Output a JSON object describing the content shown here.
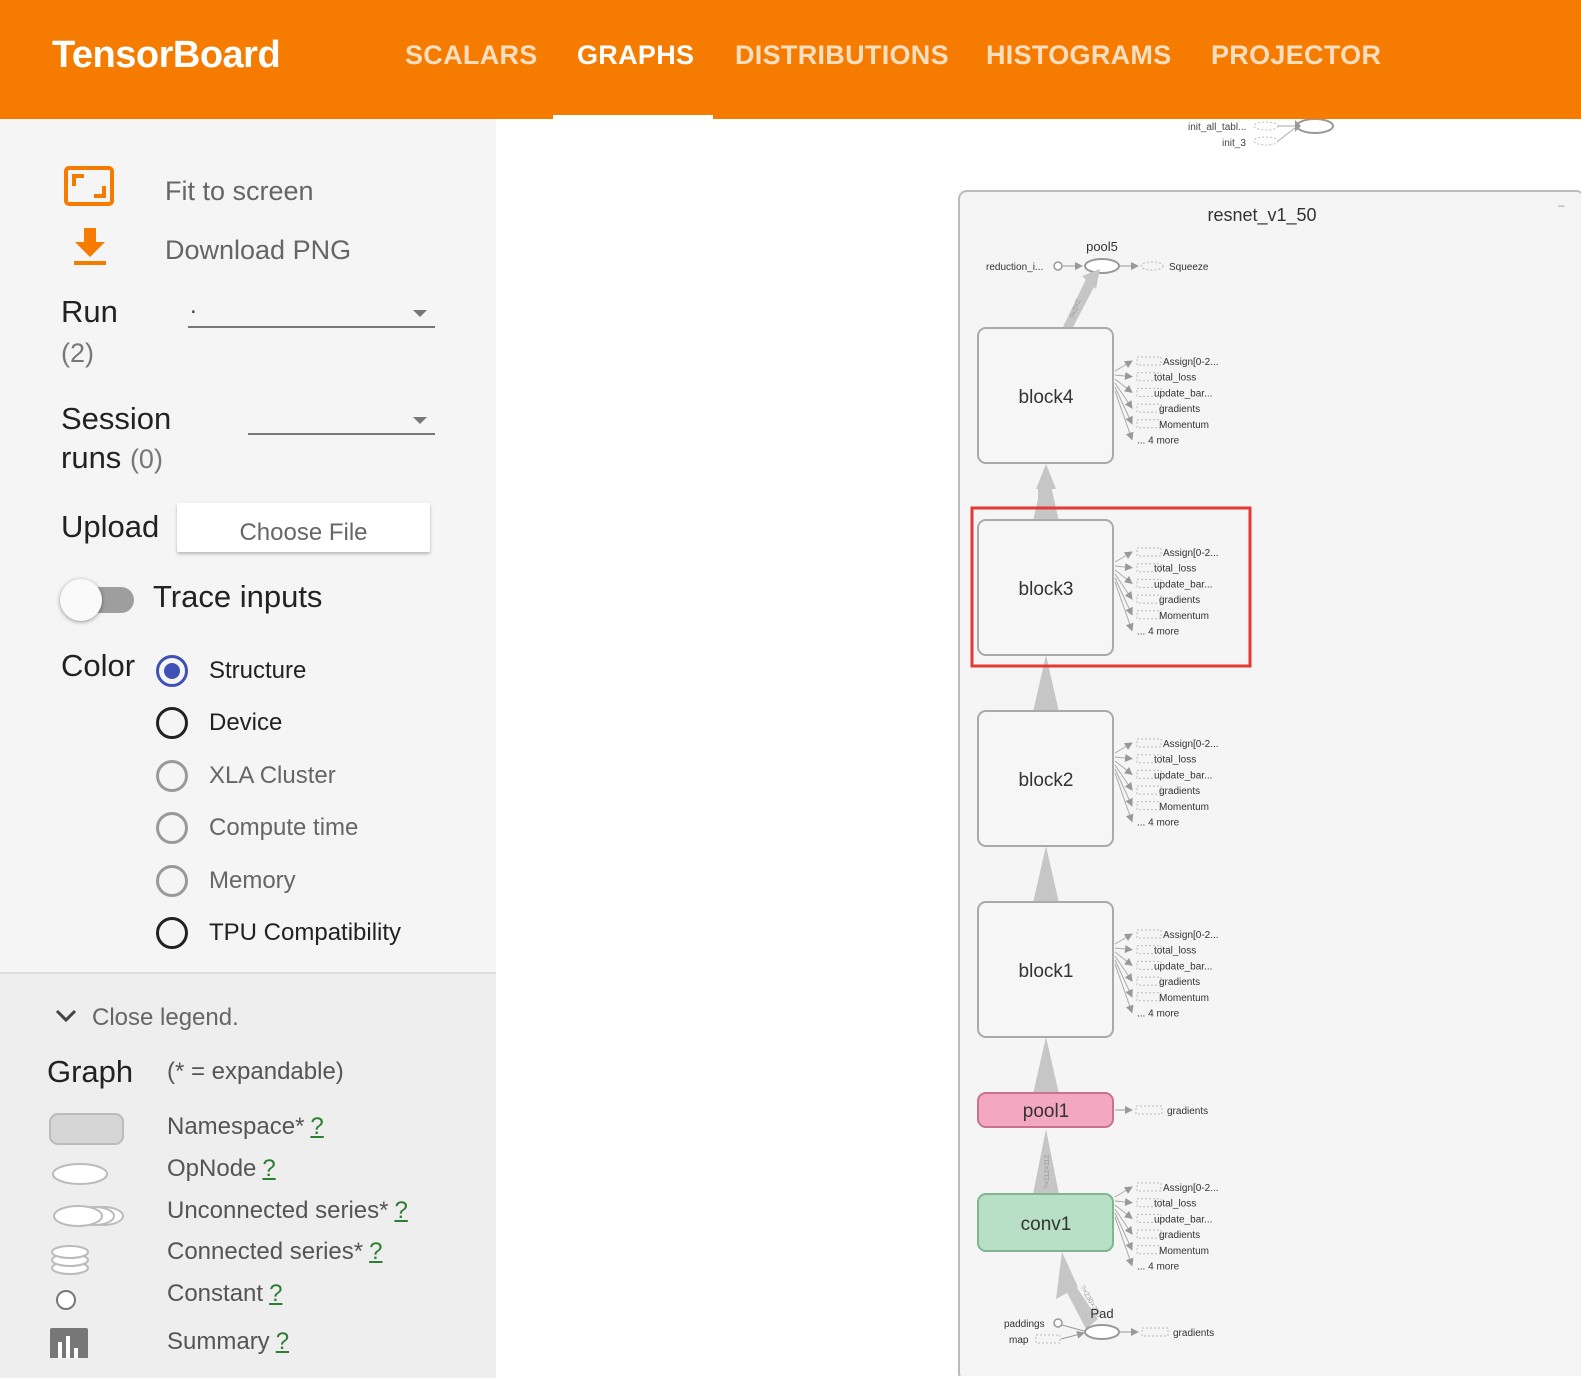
{
  "header": {
    "brand": "TensorBoard",
    "tabs": [
      {
        "label": "SCALARS",
        "active": false
      },
      {
        "label": "GRAPHS",
        "active": true
      },
      {
        "label": "DISTRIBUTIONS",
        "active": false
      },
      {
        "label": "HISTOGRAMS",
        "active": false
      },
      {
        "label": "PROJECTOR",
        "active": false
      }
    ],
    "color": "#f57c00"
  },
  "sidebar": {
    "fit_to_screen": "Fit to screen",
    "download_png": "Download PNG",
    "run_label": "Run",
    "run_count": "(2)",
    "run_value": ".",
    "session_label_1": "Session",
    "session_label_2": "runs",
    "session_count": "(0)",
    "upload_label": "Upload",
    "choose_file": "Choose File",
    "trace_inputs": "Trace inputs",
    "color_label": "Color",
    "color_options": [
      "Structure",
      "Device",
      "XLA Cluster",
      "Compute time",
      "Memory",
      "TPU Compatibility"
    ],
    "color_selected": "Structure"
  },
  "legend": {
    "toggle": "Close legend.",
    "graph_label": "Graph",
    "graph_note": "(* = expandable)",
    "items": [
      "Namespace*",
      "OpNode",
      "Unconnected series*",
      "Connected series*",
      "Constant",
      "Summary"
    ],
    "help": "?"
  },
  "graph": {
    "top_nodes": [
      "init_all_tabl...",
      "init_3"
    ],
    "namespace": "resnet_v1_50",
    "pool5": "pool5",
    "reduction": "reduction_i...",
    "squeeze": "Squeeze",
    "blocks": [
      "block4",
      "block3",
      "block2",
      "block1"
    ],
    "pool1": "pool1",
    "conv1": "conv1",
    "pad": "Pad",
    "paddings": "paddings",
    "map": "map",
    "side_outputs": [
      "Assign[0-2...",
      "total_loss",
      "update_bar...",
      "gradients",
      "Momentum",
      "... 4 more"
    ],
    "gradients": "gradients",
    "edge_labels": {
      "top": "?×2×2",
      "conv": "?×112×112",
      "pad": "?×230×230"
    },
    "colors": {
      "pool1": "#f4a7c1",
      "conv1": "#b7e0c6",
      "highlight": "#e53935"
    }
  }
}
